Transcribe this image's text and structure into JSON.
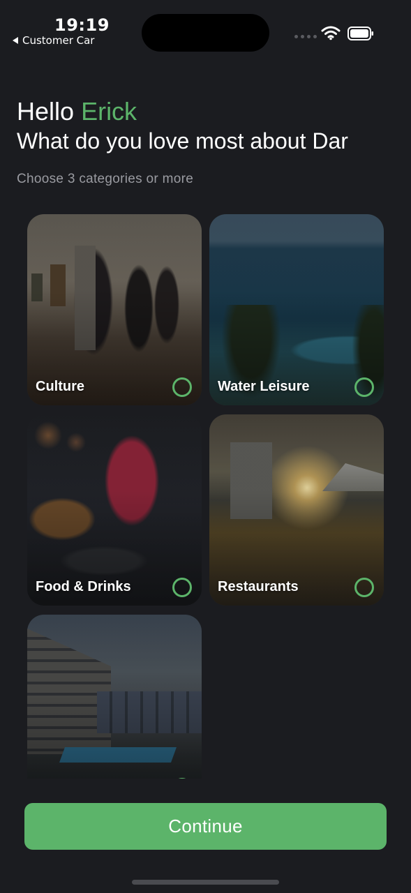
{
  "status_bar": {
    "time": "19:19",
    "back_app": "Customer Car"
  },
  "header": {
    "hello": "Hello",
    "user_name": "Erick",
    "question": "What do you love most about Dar",
    "instruction": "Choose 3 categories or more"
  },
  "categories": [
    {
      "label": "Culture",
      "selected": false,
      "image": "gallery-visitors-photo"
    },
    {
      "label": "Water Leisure",
      "selected": false,
      "image": "ocean-pool-palms-photo"
    },
    {
      "label": "Food & Drinks",
      "selected": false,
      "image": "burger-cocktail-photo"
    },
    {
      "label": "Restaurants",
      "selected": false,
      "image": "rooftop-terrace-photo"
    },
    {
      "label": "",
      "selected": false,
      "image": "hotel-pool-photo"
    }
  ],
  "actions": {
    "continue_label": "Continue"
  },
  "colors": {
    "background": "#1b1c20",
    "accent": "#5cb46a",
    "muted_text": "#9a9ba1"
  }
}
